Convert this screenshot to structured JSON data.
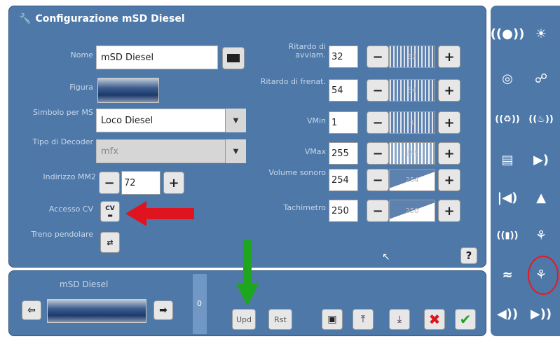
{
  "header": {
    "title": "Configurazione mSD Diesel"
  },
  "left_form": {
    "name_label": "Nome",
    "name_value": "mSD Diesel",
    "figure_label": "Figura",
    "symbol_label": "Simbolo per MS",
    "symbol_value": "Loco Diesel",
    "decoder_label": "Tipo di Decoder",
    "decoder_value": "mfx",
    "address_label": "Indirizzo MM2",
    "address_value": "72",
    "cv_label": "Accesso CV",
    "cv_button": "CV",
    "shuttle_label": "Treno pendolare"
  },
  "right_form": [
    {
      "label": "Ritardo di avviam.",
      "value": "32",
      "slider": "32"
    },
    {
      "label": "Ritardo di frenat.",
      "value": "54",
      "slider": "54"
    },
    {
      "label": "VMin",
      "value": "1",
      "slider": "1"
    },
    {
      "label": "VMax",
      "value": "255",
      "slider": "255"
    },
    {
      "label": "Volume sonoro",
      "value": "254",
      "slider": "254"
    },
    {
      "label": "Tachimetro",
      "value": "250",
      "slider": "250"
    }
  ],
  "common": {
    "minus": "−",
    "plus": "+",
    "help": "?",
    "zero": "0"
  },
  "bottom": {
    "loco_name": "mSD Diesel",
    "upd_label": "Upd",
    "rst_label": "Rst"
  },
  "colors": {
    "panel": "#4d78a8",
    "red_arrow": "#e0141e",
    "green_arrow": "#1fa61f",
    "circle": "#e31b23"
  },
  "sidebar_icons": [
    "wireless-sound-icon",
    "light-icon",
    "radio-wave-icon",
    "coupler-icon",
    "smoke-sound-icon",
    "bell-sound-icon",
    "radio-antenna-icon",
    "horn-icon",
    "horn-left-icon",
    "weight-icon",
    "radio-lock-icon",
    "crane-hook-icon",
    "wave-panto-icon",
    "hook-icon",
    "horn-small-icon",
    "horn-right-icon"
  ]
}
